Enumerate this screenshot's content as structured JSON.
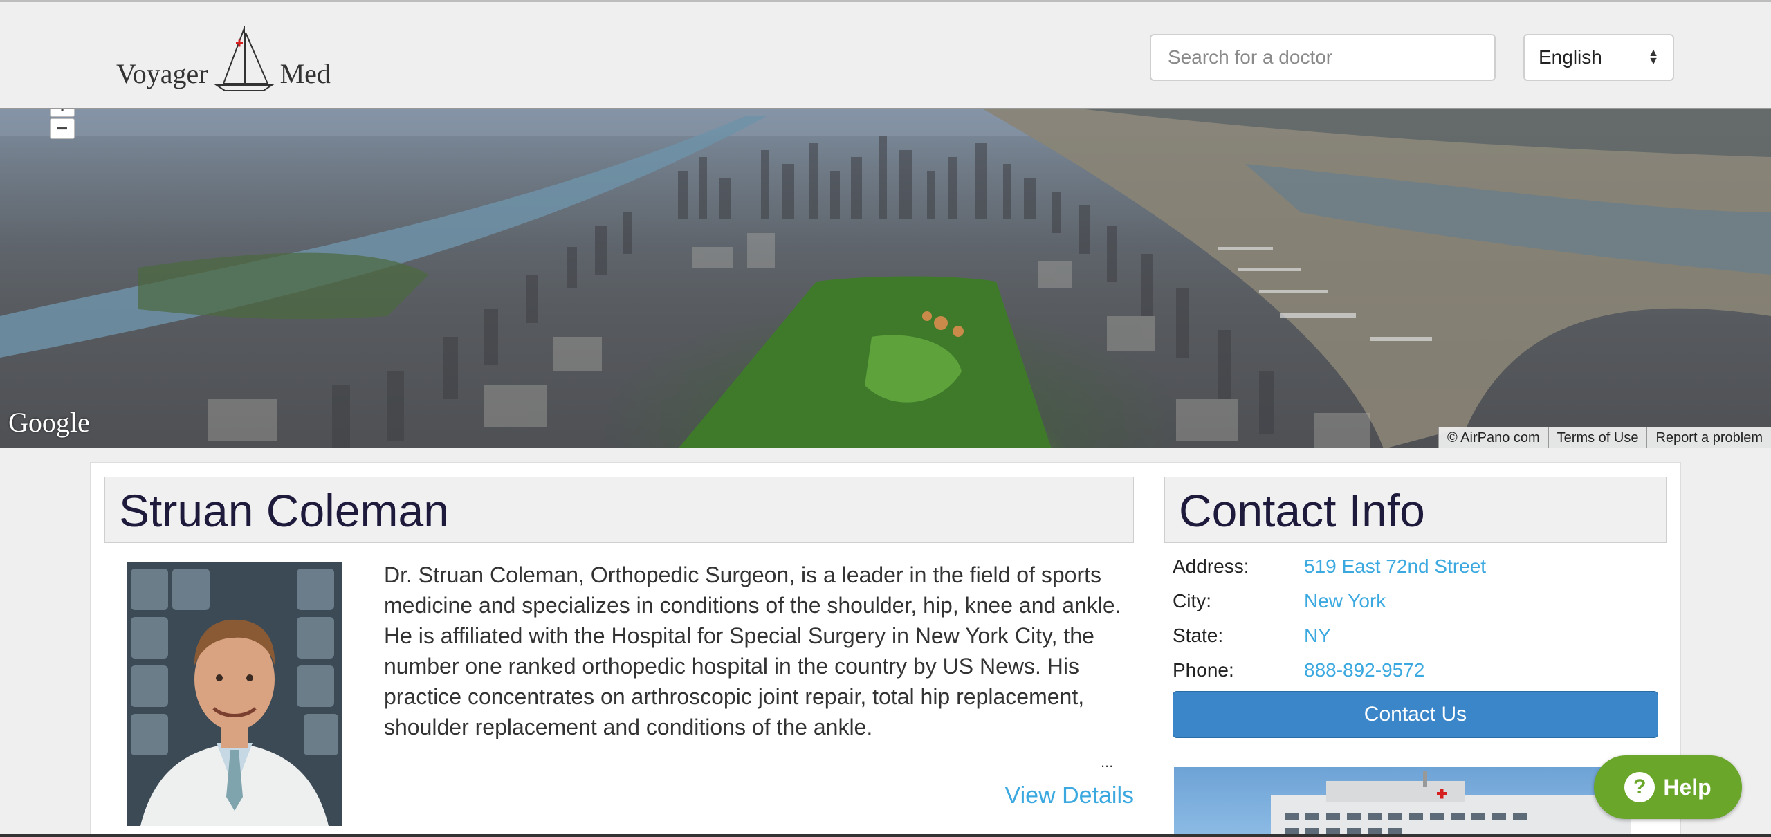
{
  "header": {
    "logo_left": "Voyager",
    "logo_right": "Med",
    "search_placeholder": "Search for a doctor",
    "language": "English"
  },
  "panorama": {
    "zoom_out_label": "−",
    "provider": "Google",
    "attribution": [
      "© AirPano com",
      "Terms of Use",
      "Report a problem"
    ]
  },
  "profile": {
    "name": "Struan Coleman",
    "bio": "Dr. Struan Coleman, Orthopedic Surgeon, is a leader in the field of sports medicine and specializes in conditions of the shoulder, hip, knee and ankle. He is affiliated with the Hospital for Special Surgery in New York City, the number one ranked orthopedic hospital in the country by US News. His practice concentrates on arthroscopic joint repair, total hip replacement, shoulder replacement and conditions of the ankle.",
    "ellipsis": "...",
    "view_details": "View Details"
  },
  "contact": {
    "title": "Contact Info",
    "rows": [
      {
        "label": "Address:",
        "value": "519 East 72nd Street"
      },
      {
        "label": "City:",
        "value": "New York"
      },
      {
        "label": "State:",
        "value": "NY"
      },
      {
        "label": "Phone:",
        "value": "888-892-9572"
      }
    ],
    "button": "Contact Us"
  },
  "help": {
    "icon": "?",
    "label": "Help"
  },
  "colors": {
    "link": "#3ba9e0",
    "primary_button": "#3a86c9",
    "help_button": "#6aa629",
    "heading": "#1e1a3c"
  }
}
